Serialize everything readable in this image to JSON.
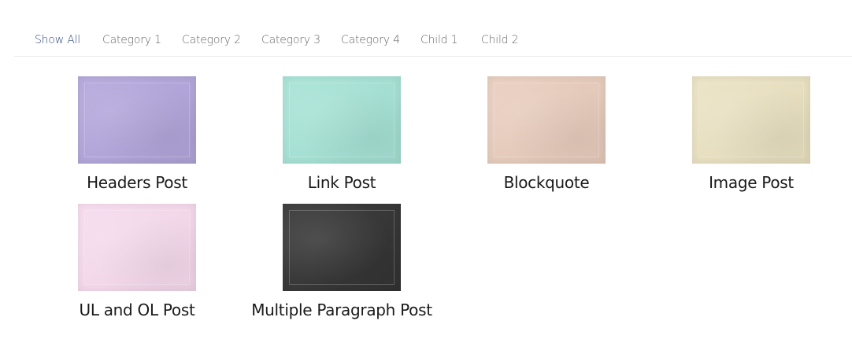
{
  "filters": [
    {
      "label": "Show All",
      "active": true
    },
    {
      "label": "Category 1",
      "active": false
    },
    {
      "label": "Category 2",
      "active": false
    },
    {
      "label": "Category 3",
      "active": false
    },
    {
      "label": "Category 4",
      "active": false
    },
    {
      "label": "Child 1",
      "active": false
    },
    {
      "label": "Child 2",
      "active": false
    }
  ],
  "posts": [
    {
      "title": "Headers Post",
      "color": "#b3a6dc"
    },
    {
      "title": "Link Post",
      "color": "#a6e3d6"
    },
    {
      "title": "Blockquote",
      "color": "#e9cdbd"
    },
    {
      "title": "Image Post",
      "color": "#ebe2c2"
    },
    {
      "title": "UL and OL Post",
      "color": "#f7dbee"
    },
    {
      "title": "Multiple Paragraph Post",
      "color": "#333333"
    }
  ]
}
